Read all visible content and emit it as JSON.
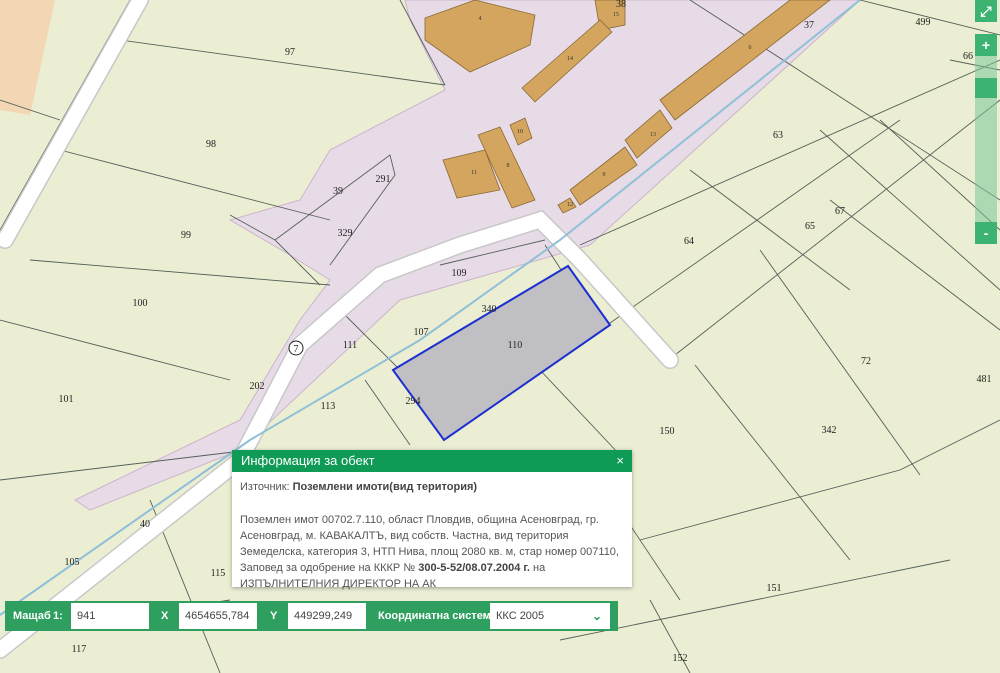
{
  "parcels": [
    "97",
    "98",
    "99",
    "100",
    "101",
    "39",
    "291",
    "329",
    "109",
    "340",
    "110",
    "107",
    "111",
    "202",
    "113",
    "294",
    "115",
    "105",
    "40",
    "117",
    "150",
    "152",
    "151",
    "342",
    "72",
    "481",
    "64",
    "65",
    "67",
    "63",
    "499",
    "66",
    "37",
    "38",
    "7"
  ],
  "buildings": [
    "4",
    "15",
    "14",
    "6",
    "10",
    "13",
    "8",
    "11",
    "9",
    "12"
  ],
  "selected_parcel": "110",
  "zoom": {
    "zoom_in": "+",
    "zoom_out": "-",
    "expand": "⤢"
  },
  "popup": {
    "title": "Информация за обект",
    "close": "×",
    "source_label": "Източник:",
    "source_value": "Поземлени имоти(вид територия)",
    "desc": "Поземлен имот 00702.7.110, област Пловдив, община Асеновград, гр. Асеновград, м. КАВАКАЛТЪ, вид собств. Частна, вид територия Земеделска, категория 3, НТП Нива, площ 2080 кв. м, стар номер 007110, Заповед за одобрение на КККР №",
    "order": "300-5-52/08.07.2004 г.",
    "desc_end": "на ИЗПЪЛНИТЕЛНИЯ ДИРЕКТОР НА АК"
  },
  "coords": {
    "scale_label": "Мащаб",
    "scale_prefix": "1:",
    "scale_value": "941",
    "x_label": "X",
    "x_value": "4654655,784",
    "y_label": "Y",
    "y_value": "449299,249",
    "system_label": "Координатна система",
    "system_value": "ККС 2005"
  },
  "colors": {
    "land": "#ebeed2",
    "urban": "#e6dbe6",
    "building": "#d3a55e",
    "selected_fill": "#c0c0c4",
    "selected_border": "#1d2fd0",
    "ui_green": "#2e9f5f",
    "header_green": "#0f9a55"
  }
}
